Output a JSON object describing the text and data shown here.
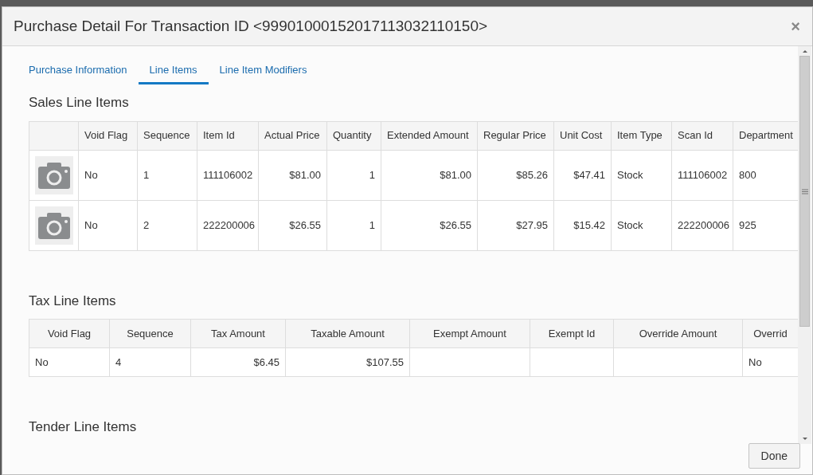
{
  "dialog": {
    "title": "Purchase Detail For Transaction ID <99901000152017113032110150>",
    "close": "×"
  },
  "tabs": [
    {
      "label": "Purchase Information",
      "selected": false
    },
    {
      "label": "Line Items",
      "selected": true
    },
    {
      "label": "Line Item Modifiers",
      "selected": false
    }
  ],
  "sections": [
    {
      "title": "Sales Line Items",
      "table": {
        "columns": [
          "Void Flag",
          "Sequence",
          "Item Id",
          "Actual Price",
          "Quantity",
          "Extended Amount",
          "Regular Price",
          "Unit Cost",
          "Item Type",
          "Scan Id",
          "Department"
        ],
        "rows": [
          [
            "No",
            "1",
            "111106002",
            "$81.00",
            "1",
            "$81.00",
            "$85.26",
            "$47.41",
            "Stock",
            "111106002",
            "800"
          ],
          [
            "No",
            "2",
            "222200006",
            "$26.55",
            "1",
            "$26.55",
            "$27.95",
            "$15.42",
            "Stock",
            "222200006",
            "925"
          ]
        ]
      }
    },
    {
      "title": "Tax Line Items",
      "table": {
        "columns": [
          "Void Flag",
          "Sequence",
          "Tax Amount",
          "Taxable Amount",
          "Exempt Amount",
          "Exempt Id",
          "Override Amount",
          "Overrid"
        ],
        "rows": [
          [
            "No",
            "4",
            "$6.45",
            "$107.55",
            "",
            "",
            "",
            "No"
          ]
        ]
      }
    },
    {
      "title": "Tender Line Items"
    }
  ],
  "buttons": [
    {
      "label": "Done"
    }
  ]
}
